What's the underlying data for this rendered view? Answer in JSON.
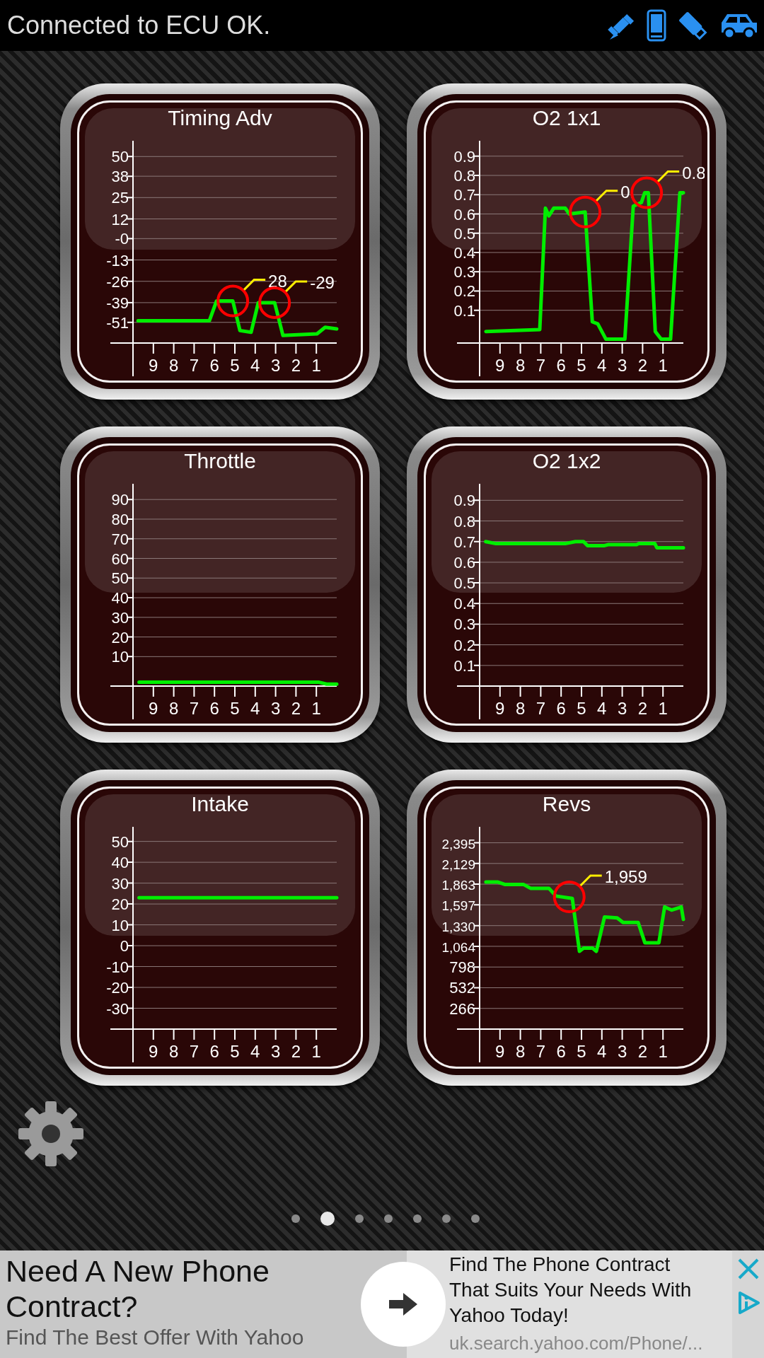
{
  "status_bar": {
    "message": "Connected to ECU OK."
  },
  "gauges": [
    {
      "chart_data": {
        "type": "line",
        "title": "Timing Adv",
        "x": [
          9.75,
          8.54,
          6.25,
          5.9,
          5.1,
          4.75,
          4.2,
          3.85,
          3.05,
          2.64,
          0.97,
          0.57,
          0
        ],
        "series": [
          {
            "color": "#00ee00",
            "values": [
              -50,
              -50,
              -50,
              -38,
              -38,
              -56,
              -57,
              -39,
              -39,
              -59,
              -58,
              -54,
              -55
            ]
          }
        ],
        "xlim": [
          10,
          0
        ],
        "ylim": [
          -63.6,
          59.6
        ],
        "grid": true,
        "xticks": [
          9,
          8,
          7,
          6,
          5,
          4,
          3,
          2,
          1
        ],
        "yticks": [
          50,
          38,
          25,
          12,
          {
            "value": 0,
            "label": "-0"
          },
          -13,
          -26,
          -39,
          -51
        ],
        "annotations": [
          {
            "x": 5.1,
            "y": -38,
            "text": "28"
          },
          {
            "x": 3.05,
            "y": -39,
            "text": "-29"
          }
        ]
      }
    },
    {
      "chart_data": {
        "type": "line",
        "title": "O2 1x1",
        "x": [
          9.69,
          7.05,
          6.77,
          6.6,
          6.36,
          5.8,
          5.6,
          4.82,
          4.47,
          4.2,
          3.8,
          2.87,
          2.46,
          2.06,
          1.9,
          1.72,
          1.38,
          1.09,
          0.63,
          0.17,
          0
        ],
        "series": [
          {
            "color": "#00ee00",
            "values": [
              -0.01,
              0,
              0.63,
              0.59,
              0.63,
              0.63,
              0.6,
              0.61,
              0.04,
              0.03,
              -0.05,
              -0.05,
              0.64,
              0.66,
              0.71,
              0.71,
              -0.01,
              -0.05,
              -0.05,
              0.71,
              0.71
            ]
          }
        ],
        "xlim": [
          10,
          0
        ],
        "ylim": [
          -0.07,
          0.98
        ],
        "grid": true,
        "xticks": [
          9,
          8,
          7,
          6,
          5,
          4,
          3,
          2,
          1
        ],
        "yticks": [
          0.9,
          0.8,
          0.7,
          0.6,
          0.5,
          0.4,
          0.3,
          0.2,
          0.1
        ],
        "annotations": [
          {
            "x": 4.82,
            "y": 0.61,
            "text": "0."
          },
          {
            "x": 1.8,
            "y": 0.71,
            "text": "0.8"
          }
        ]
      }
    },
    {
      "chart_data": {
        "type": "line",
        "title": "Throttle",
        "x": [
          9.7,
          0.9,
          0.5,
          0
        ],
        "series": [
          {
            "color": "#00ee00",
            "values": [
              -3,
              -3,
              -4,
              -4
            ]
          }
        ],
        "xlim": [
          10,
          0
        ],
        "ylim": [
          -5,
          98
        ],
        "grid": true,
        "xticks": [
          9,
          8,
          7,
          6,
          5,
          4,
          3,
          2,
          1
        ],
        "yticks": [
          90,
          80,
          70,
          60,
          50,
          40,
          30,
          20,
          10
        ]
      }
    },
    {
      "chart_data": {
        "type": "line",
        "title": "O2 1x2",
        "x": [
          9.7,
          9.2,
          5.8,
          5.3,
          4.9,
          4.7,
          3.9,
          3.7,
          2.3,
          2.2,
          1.4,
          1.3,
          0
        ],
        "series": [
          {
            "color": "#00ee00",
            "values": [
              0.7,
              0.69,
              0.69,
              0.7,
              0.7,
              0.68,
              0.68,
              0.685,
              0.685,
              0.69,
              0.69,
              0.67,
              0.67
            ]
          }
        ],
        "xlim": [
          10,
          0
        ],
        "ylim": [
          0,
          0.98
        ],
        "grid": true,
        "xticks": [
          9,
          8,
          7,
          6,
          5,
          4,
          3,
          2,
          1
        ],
        "yticks": [
          0.9,
          0.8,
          0.7,
          0.6,
          0.5,
          0.4,
          0.3,
          0.2,
          0.1
        ]
      }
    },
    {
      "chart_data": {
        "type": "line",
        "title": "Intake",
        "x": [
          9.7,
          0
        ],
        "series": [
          {
            "color": "#00ee00",
            "values": [
              23,
              23
            ]
          }
        ],
        "xlim": [
          10,
          0
        ],
        "ylim": [
          -40,
          57
        ],
        "grid": true,
        "xticks": [
          9,
          8,
          7,
          6,
          5,
          4,
          3,
          2,
          1
        ],
        "yticks": [
          50,
          40,
          30,
          20,
          10,
          0,
          -10,
          -20,
          -30
        ]
      }
    },
    {
      "chart_data": {
        "type": "line",
        "title": "Revs",
        "x": [
          9.69,
          9.1,
          8.77,
          7.85,
          7.5,
          6.6,
          6.25,
          5.45,
          5.1,
          4.9,
          4.45,
          4.27,
          3.87,
          3.25,
          2.96,
          2.22,
          1.89,
          1.2,
          0.92,
          0.57,
          0.1,
          0
        ],
        "series": [
          {
            "color": "#00ee00",
            "values": [
              1890,
              1890,
              1860,
              1860,
              1810,
              1810,
              1710,
              1680,
              1000,
              1040,
              1040,
              1000,
              1440,
              1430,
              1370,
              1370,
              1110,
              1110,
              1570,
              1530,
              1570,
              1410
            ]
          }
        ],
        "xlim": [
          10,
          0
        ],
        "ylim": [
          0,
          2600
        ],
        "grid": true,
        "xticks": [
          9,
          8,
          7,
          6,
          5,
          4,
          3,
          2,
          1
        ],
        "yticks": [
          {
            "value": 2395,
            "label": "2,395"
          },
          {
            "value": 2129,
            "label": "2,129"
          },
          {
            "value": 1863,
            "label": "1,863"
          },
          {
            "value": 1597,
            "label": "1,597"
          },
          {
            "value": 1330,
            "label": "1,330"
          },
          {
            "value": 1064,
            "label": "1,064"
          },
          {
            "value": 798,
            "label": "798"
          },
          {
            "value": 532,
            "label": "532"
          },
          {
            "value": 266,
            "label": "266"
          }
        ],
        "annotations": [
          {
            "x": 5.6,
            "y": 1700,
            "text": "1,959"
          }
        ]
      }
    }
  ],
  "page_dots": [
    {
      "selected": false
    },
    {
      "selected": true
    },
    {
      "selected": false
    },
    {
      "selected": false
    },
    {
      "selected": false
    },
    {
      "selected": false
    },
    {
      "selected": false
    }
  ],
  "ad": {
    "headline": "Need A New Phone Contract?",
    "subline": "Find The Best Offer With Yahoo",
    "description": "Find The Phone Contract That Suits Your Needs With Yahoo Today!",
    "url": "uk.search.yahoo.com/Phone/..."
  }
}
